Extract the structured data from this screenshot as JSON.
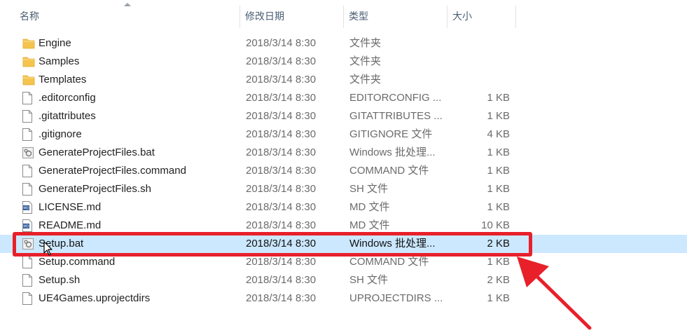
{
  "columns": {
    "name": "名称",
    "date": "修改日期",
    "type": "类型",
    "size": "大小"
  },
  "files": [
    {
      "name": "Engine",
      "date": "2018/3/14 8:30",
      "type": "文件夹",
      "size": "",
      "icon": "folder-icon"
    },
    {
      "name": "Samples",
      "date": "2018/3/14 8:30",
      "type": "文件夹",
      "size": "",
      "icon": "folder-icon"
    },
    {
      "name": "Templates",
      "date": "2018/3/14 8:30",
      "type": "文件夹",
      "size": "",
      "icon": "folder-icon"
    },
    {
      "name": ".editorconfig",
      "date": "2018/3/14 8:30",
      "type": "EDITORCONFIG ...",
      "size": "1 KB",
      "icon": "file-icon"
    },
    {
      "name": ".gitattributes",
      "date": "2018/3/14 8:30",
      "type": "GITATTRIBUTES ...",
      "size": "1 KB",
      "icon": "file-icon"
    },
    {
      "name": ".gitignore",
      "date": "2018/3/14 8:30",
      "type": "GITIGNORE 文件",
      "size": "4 KB",
      "icon": "file-icon"
    },
    {
      "name": "GenerateProjectFiles.bat",
      "date": "2018/3/14 8:30",
      "type": "Windows 批处理...",
      "size": "1 KB",
      "icon": "batch-file-icon"
    },
    {
      "name": "GenerateProjectFiles.command",
      "date": "2018/3/14 8:30",
      "type": "COMMAND 文件",
      "size": "1 KB",
      "icon": "file-icon"
    },
    {
      "name": "GenerateProjectFiles.sh",
      "date": "2018/3/14 8:30",
      "type": "SH 文件",
      "size": "1 KB",
      "icon": "file-icon"
    },
    {
      "name": "LICENSE.md",
      "date": "2018/3/14 8:30",
      "type": "MD 文件",
      "size": "1 KB",
      "icon": "markdown-file-icon"
    },
    {
      "name": "README.md",
      "date": "2018/3/14 8:30",
      "type": "MD 文件",
      "size": "10 KB",
      "icon": "markdown-file-icon"
    },
    {
      "name": "Setup.bat",
      "date": "2018/3/14 8:30",
      "type": "Windows 批处理...",
      "size": "2 KB",
      "icon": "batch-file-icon",
      "selected": true
    },
    {
      "name": "Setup.command",
      "date": "2018/3/14 8:30",
      "type": "COMMAND 文件",
      "size": "1 KB",
      "icon": "file-icon"
    },
    {
      "name": "Setup.sh",
      "date": "2018/3/14 8:30",
      "type": "SH 文件",
      "size": "2 KB",
      "icon": "file-icon"
    },
    {
      "name": "UE4Games.uprojectdirs",
      "date": "2018/3/14 8:30",
      "type": "UPROJECTDIRS ...",
      "size": "1 KB",
      "icon": "file-icon"
    }
  ],
  "colors": {
    "selection": "#cce8ff",
    "highlight": "#e8202a",
    "folder": "#f4c44e"
  }
}
